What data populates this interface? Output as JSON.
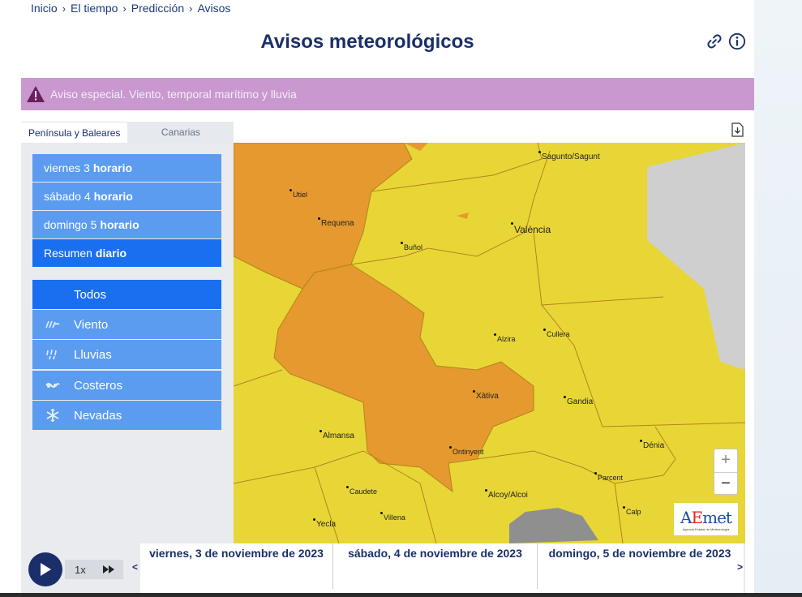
{
  "breadcrumb": [
    "Inicio",
    "El tiempo",
    "Predicción",
    "Avisos"
  ],
  "page_title": "Avisos meteorológicos",
  "header_icons": [
    "link-icon",
    "info-icon"
  ],
  "alert": {
    "icon": "warning-triangle-icon",
    "text": "Aviso especial. Viento, temporal marítimo y lluvia",
    "color": "#c898cf"
  },
  "tabs": [
    {
      "label": "Península y Baleares",
      "active": true
    },
    {
      "label": "Canarias",
      "active": false
    }
  ],
  "day_buttons": [
    {
      "prefix": "viernes 3",
      "suffix": "horario",
      "selected": false
    },
    {
      "prefix": "sábado 4",
      "suffix": "horario",
      "selected": false
    },
    {
      "prefix": "domingo 5",
      "suffix": "horario",
      "selected": false
    },
    {
      "prefix": "Resumen",
      "suffix": "diario",
      "selected": true
    }
  ],
  "type_buttons": [
    {
      "label": "Todos",
      "icon": "",
      "selected": true
    },
    {
      "label": "Viento",
      "icon": "wind-icon",
      "selected": false
    },
    {
      "label": "Lluvias",
      "icon": "rain-icon",
      "selected": false
    },
    {
      "label": "Costeros",
      "icon": "waves-icon",
      "selected": false
    },
    {
      "label": "Nevadas",
      "icon": "snowflake-icon",
      "selected": false
    }
  ],
  "map": {
    "cities": [
      "Sagunto/Sagunt",
      "Utiel",
      "Requena",
      "València",
      "Buñol",
      "Alzira",
      "Cullera",
      "Xàtiva",
      "Gandia",
      "Almansa",
      "Ontinyent",
      "Dénia",
      "Parcent",
      "Caudete",
      "Alcoy/Alcoi",
      "Villena",
      "Calp",
      "Yecla"
    ],
    "colors": {
      "yellow": "#e8d636",
      "orange": "#e5992e",
      "sea": "#cfcfcf"
    },
    "zoom_in": "+",
    "zoom_out": "−",
    "logo": {
      "main_a": "A",
      "main_e": "E",
      "main_rest": "met",
      "sub": "Agencia Estatal de Meteorología"
    }
  },
  "timeline": {
    "speed": "1x",
    "prev": "<",
    "next": ">",
    "dates": [
      "viernes, 3 de noviembre de 2023",
      "sábado, 4 de noviembre de 2023",
      "domingo, 5 de noviembre de 2023"
    ]
  }
}
